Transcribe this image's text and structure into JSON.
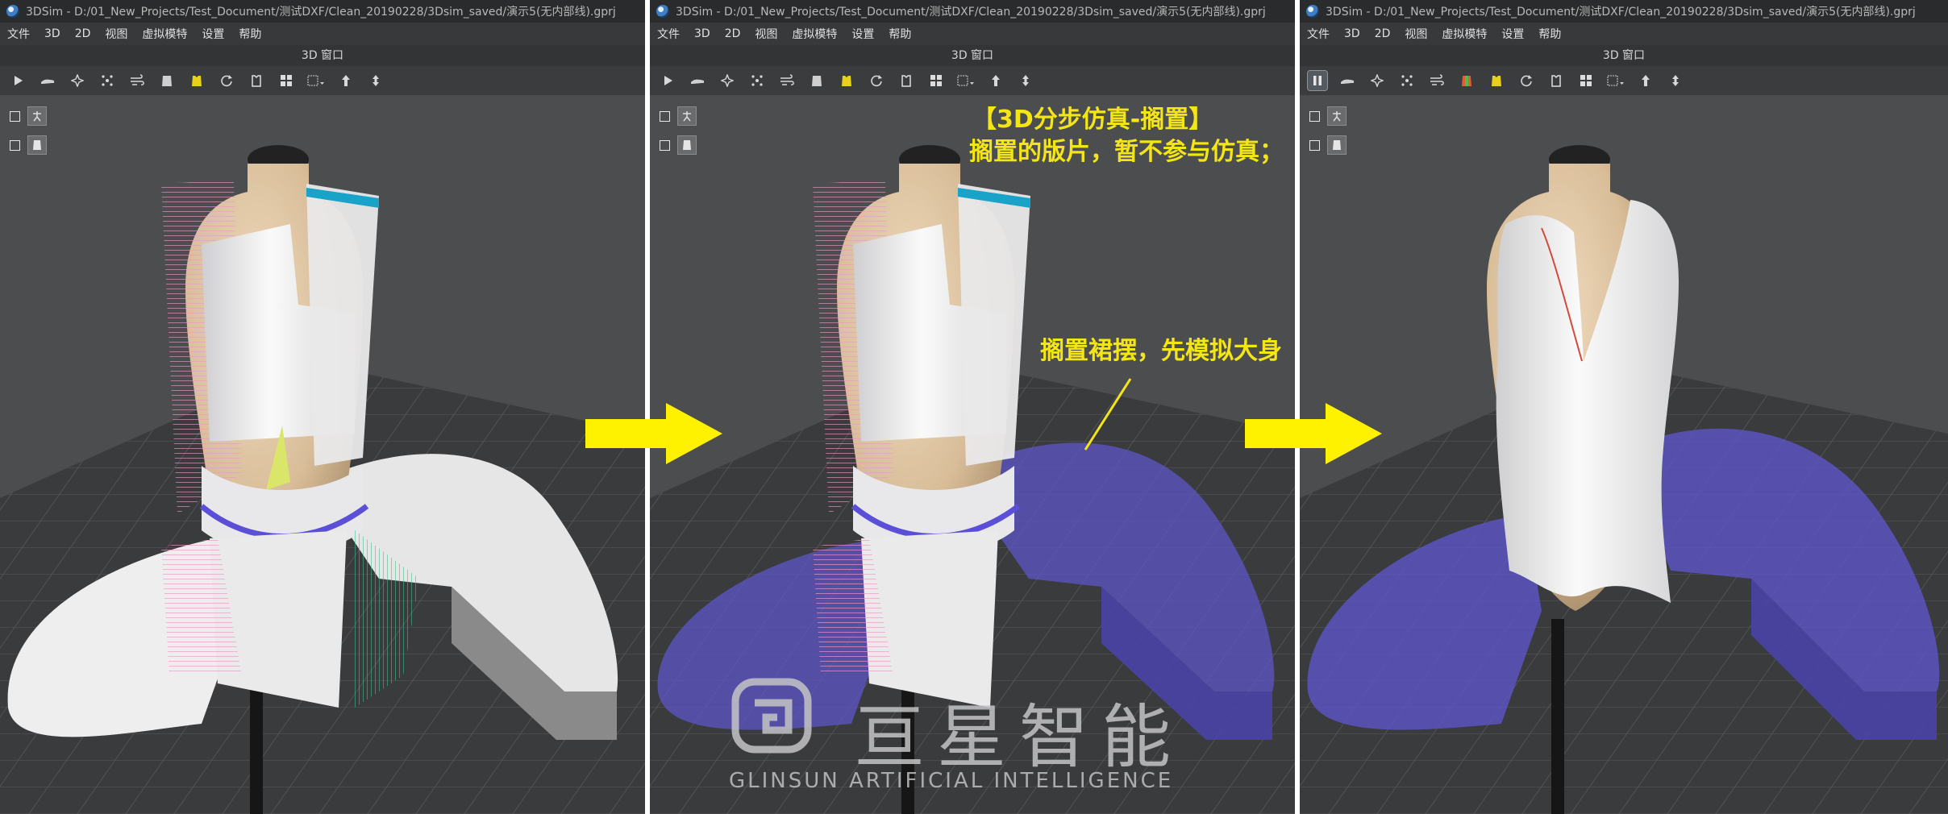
{
  "panels": [
    {
      "title": "3DSim - D:/01_New_Projects/Test_Document/测试DXF/Clean_20190228/3Dsim_saved/演示5(无内部线).gprj",
      "menu": [
        "文件",
        "3D",
        "2D",
        "视图",
        "虚拟模特",
        "设置",
        "帮助"
      ],
      "viewport_title": "3D 窗口",
      "sim_state": "play"
    },
    {
      "title": "3DSim - D:/01_New_Projects/Test_Document/测试DXF/Clean_20190228/3Dsim_saved/演示5(无内部线).gprj",
      "menu": [
        "文件",
        "3D",
        "2D",
        "视图",
        "虚拟模特",
        "设置",
        "帮助"
      ],
      "viewport_title": "3D 窗口",
      "sim_state": "play"
    },
    {
      "title": "3DSim - D:/01_New_Projects/Test_Document/测试DXF/Clean_20190228/3Dsim_saved/演示5(无内部线).gprj",
      "menu": [
        "文件",
        "3D",
        "2D",
        "视图",
        "虚拟模特",
        "设置",
        "帮助"
      ],
      "viewport_title": "3D 窗口",
      "sim_state": "pause"
    }
  ],
  "toolbar_icons": [
    "play-icon",
    "hand-drag-icon",
    "pin-icon",
    "points-icon",
    "wind-icon",
    "garment-gray-icon",
    "garment-yellow-icon",
    "refresh-icon",
    "garment-outline-icon",
    "grid-pieces-icon",
    "grid-dropdown-icon",
    "arrow-up-icon",
    "arrow-up-alt-icon"
  ],
  "annotations": {
    "heading": "【3D分步仿真-搁置】",
    "subheading": "搁置的版片，暂不参与仿真；",
    "callout": "搁置裙摆，先模拟大身"
  },
  "watermark": {
    "chinese": "亘星智能",
    "english": "GLINSUN  ARTIFICIAL INTELLIGENCE"
  },
  "colors": {
    "annotation": "#f3e516",
    "flow_arrow": "#fff200",
    "shelved_piece": "#5e55c8",
    "cloth_white": "#f2f2f2"
  }
}
